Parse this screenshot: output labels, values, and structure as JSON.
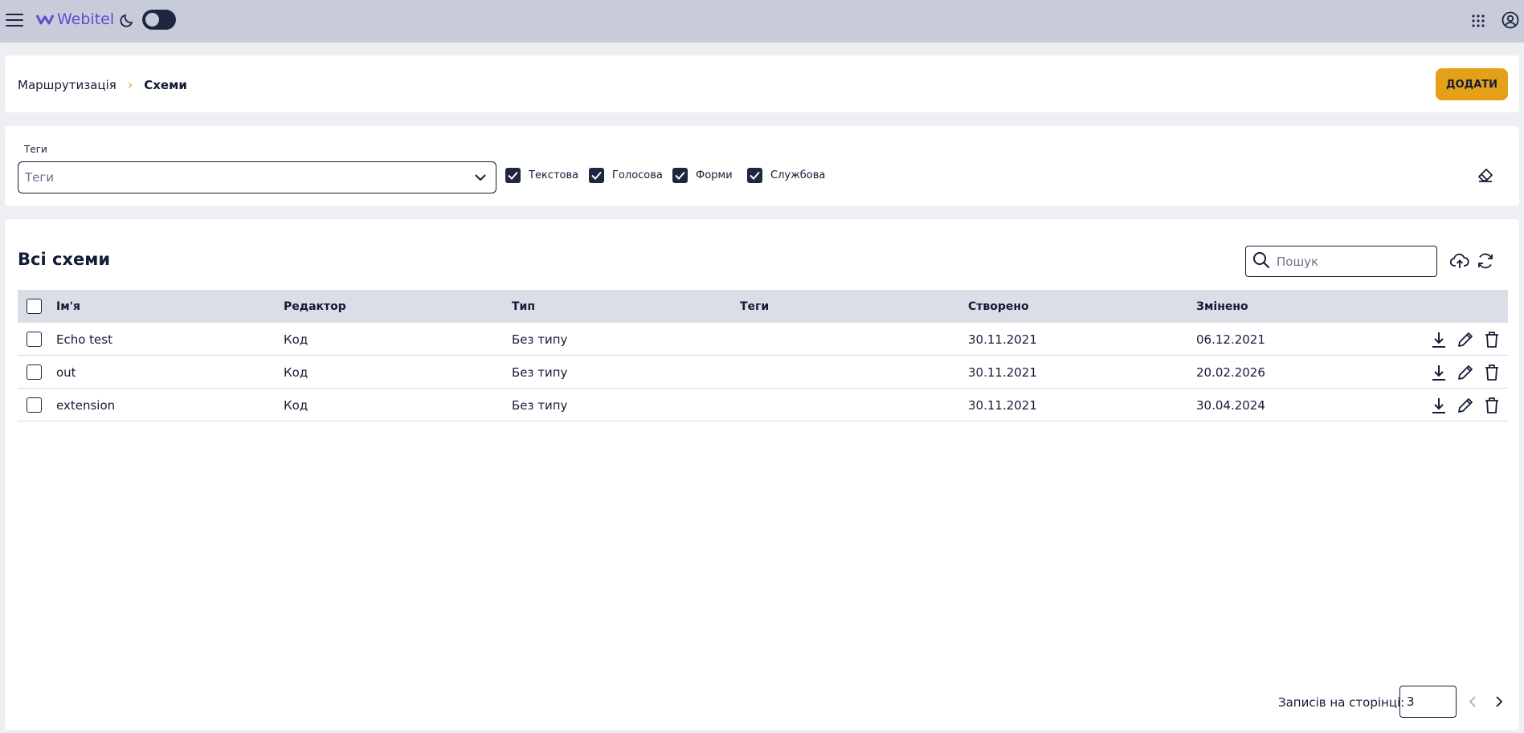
{
  "header": {
    "logo_text": "Webitel",
    "menu_icon": "hamburger-icon",
    "theme_icon": "moon-icon",
    "apps_icon": "grid-icon",
    "account_icon": "user-circle-icon",
    "dark_mode": false
  },
  "breadcrumb": {
    "parent": "Маршрутизація",
    "separator": "›",
    "current": "Схеми"
  },
  "toolbar": {
    "add_label": "ДОДАТИ"
  },
  "filters": {
    "tags_label": "Теги",
    "tags_placeholder": "Теги",
    "checkboxes": [
      {
        "label": "Текстова",
        "checked": true
      },
      {
        "label": "Голосова",
        "checked": true
      },
      {
        "label": "Форми",
        "checked": true
      },
      {
        "label": "Службова",
        "checked": true
      }
    ],
    "clear_icon": "eraser-icon"
  },
  "table": {
    "title": "Всі схеми",
    "search_placeholder": "Пошук",
    "columns": [
      "Ім'я",
      "Редактор",
      "Тип",
      "Теги",
      "Створено",
      "Змінено"
    ],
    "rows": [
      {
        "name": "Echo test",
        "editor": "Код",
        "type": "Без типу",
        "tags": "",
        "created": "30.11.2021",
        "modified": "06.12.2021"
      },
      {
        "name": "out",
        "editor": "Код",
        "type": "Без типу",
        "tags": "",
        "created": "30.11.2021",
        "modified": "20.02.2026"
      },
      {
        "name": "extension",
        "editor": "Код",
        "type": "Без типу",
        "tags": "",
        "created": "30.11.2021",
        "modified": "30.04.2024"
      }
    ]
  },
  "pagination": {
    "per_page_label": "Записів на сторінці:",
    "per_page_value": "3"
  },
  "colors": {
    "accent": "#e5a019",
    "dark": "#1f2640",
    "topbar": "#c8ccda",
    "header_row": "#dcdee7"
  }
}
